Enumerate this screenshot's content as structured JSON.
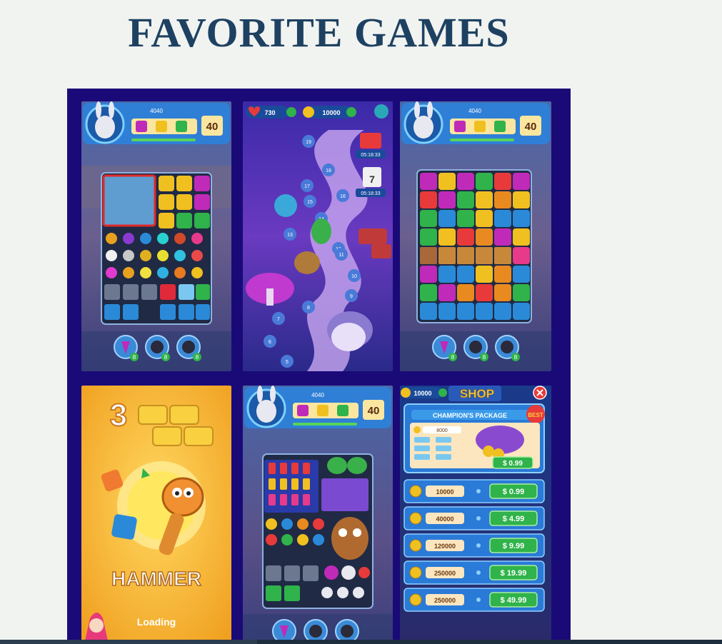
{
  "page": {
    "title": "FAVORITE GAMES"
  },
  "screens": {
    "level": {
      "moves": "40",
      "score": "4040",
      "booster_counts": [
        "8",
        "8",
        "8"
      ]
    },
    "map": {
      "lives": "730",
      "coins": "10000",
      "timers": [
        "05:18:33",
        "05:18:33"
      ],
      "calendar_day": "7",
      "level_numbers": [
        "19",
        "18",
        "17",
        "16",
        "15",
        "14",
        "13",
        "12",
        "11",
        "10",
        "9",
        "8",
        "7",
        "6",
        "5"
      ]
    },
    "loading": {
      "count": "3",
      "caption": "HAMMER",
      "status": "Loading"
    },
    "shop": {
      "coins": "10000",
      "title": "SHOP",
      "package_title": "CHAMPION'S PACKAGE",
      "badge": "BEST",
      "package_coins": "8000",
      "package_price": "$ 0.99",
      "offers": [
        {
          "coins": "10000",
          "price": "$ 0.99"
        },
        {
          "coins": "40000",
          "price": "$ 4.99"
        },
        {
          "coins": "120000",
          "price": "$ 9.99"
        },
        {
          "coins": "250000",
          "price": "$ 19.99"
        },
        {
          "coins": "250000",
          "price": "$ 49.99"
        }
      ]
    }
  }
}
